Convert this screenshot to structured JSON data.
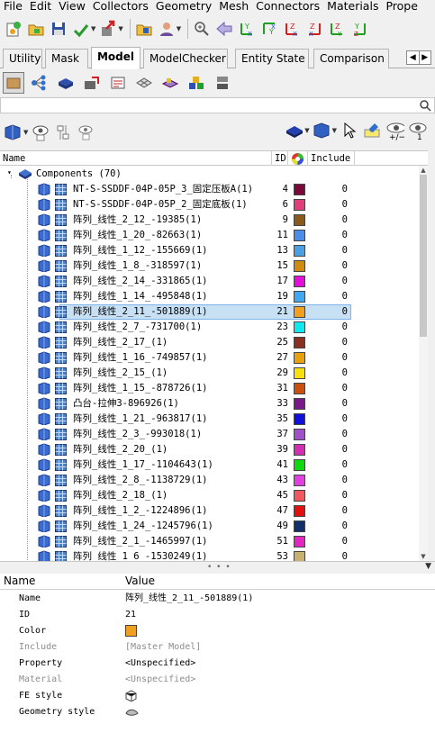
{
  "menu": [
    "File",
    "Edit",
    "View",
    "Collectors",
    "Geometry",
    "Mesh",
    "Connectors",
    "Materials",
    "Prope"
  ],
  "tabs": [
    {
      "label": "Utility",
      "active": false
    },
    {
      "label": "Mask",
      "active": false
    },
    {
      "label": "Model",
      "active": true
    },
    {
      "label": "ModelChecker",
      "active": false
    },
    {
      "label": "Entity State",
      "active": false
    },
    {
      "label": "Comparison",
      "active": false
    }
  ],
  "tab_nav": {
    "left": "◀",
    "right": "▶"
  },
  "columns": {
    "name": "Name",
    "id": "ID",
    "include": "Include"
  },
  "tree": {
    "root_label": "Components (70)",
    "rows": [
      {
        "name": "NT-S-SSDDF-04P-05P_3_固定压板A(1)",
        "id": "4",
        "color": "#7a0a3c",
        "include": "0"
      },
      {
        "name": "NT-S-SSDDF-04P-05P_2_固定底板(1)",
        "id": "6",
        "color": "#e0407a",
        "include": "0"
      },
      {
        "name": "阵列_线性_2_12_-19385(1)",
        "id": "9",
        "color": "#8a5a1a",
        "include": "0"
      },
      {
        "name": "阵列_线性_1_20_-82663(1)",
        "id": "11",
        "color": "#4a8de8",
        "include": "0"
      },
      {
        "name": "阵列_线性_1_12_-155669(1)",
        "id": "13",
        "color": "#4aa0e0",
        "include": "0"
      },
      {
        "name": "阵列_线性_1_8_-318597(1)",
        "id": "15",
        "color": "#d08a10",
        "include": "0"
      },
      {
        "name": "阵列_线性_2_14_-331865(1)",
        "id": "17",
        "color": "#e010d8",
        "include": "0"
      },
      {
        "name": "阵列_线性_1_14_-495848(1)",
        "id": "19",
        "color": "#40a8f0",
        "include": "0"
      },
      {
        "name": "阵列_线性_2_11_-501889(1)",
        "id": "21",
        "color": "#f0a020",
        "include": "0",
        "selected": true
      },
      {
        "name": "阵列_线性_2_7_-731700(1)",
        "id": "23",
        "color": "#10e8f0",
        "include": "0"
      },
      {
        "name": "阵列_线性_2_17_(1)",
        "id": "25",
        "color": "#8a3020",
        "include": "0"
      },
      {
        "name": "阵列_线性_1_16_-749857(1)",
        "id": "27",
        "color": "#e8a010",
        "include": "0"
      },
      {
        "name": "阵列_线性_2_15_(1)",
        "id": "29",
        "color": "#f8e010",
        "include": "0"
      },
      {
        "name": "阵列_线性_1_15_-878726(1)",
        "id": "31",
        "color": "#c85010",
        "include": "0"
      },
      {
        "name": "凸台-拉伸3-896926(1)",
        "id": "33",
        "color": "#7a1a8a",
        "include": "0"
      },
      {
        "name": "阵列_线性_1_21_-963817(1)",
        "id": "35",
        "color": "#1010d8",
        "include": "0"
      },
      {
        "name": "阵列_线性_2_3_-993018(1)",
        "id": "37",
        "color": "#a050c8",
        "include": "0"
      },
      {
        "name": "阵列_线性_2_20_(1)",
        "id": "39",
        "color": "#d030b0",
        "include": "0"
      },
      {
        "name": "阵列_线性_1_17_-1104643(1)",
        "id": "41",
        "color": "#10d810",
        "include": "0"
      },
      {
        "name": "阵列_线性_2_8_-1138729(1)",
        "id": "43",
        "color": "#e040e0",
        "include": "0"
      },
      {
        "name": "阵列_线性_2_18_(1)",
        "id": "45",
        "color": "#f05860",
        "include": "0"
      },
      {
        "name": "阵列_线性_1_2_-1224896(1)",
        "id": "47",
        "color": "#e01010",
        "include": "0"
      },
      {
        "name": "阵列_线性_1_24_-1245796(1)",
        "id": "49",
        "color": "#10306a",
        "include": "0"
      },
      {
        "name": "阵列_线性_2_1_-1465997(1)",
        "id": "51",
        "color": "#e028c0",
        "include": "0"
      },
      {
        "name": "阵列_线性_1_6_-1530249(1)",
        "id": "53",
        "color": "#c8b070",
        "include": "0"
      }
    ]
  },
  "properties": {
    "header": {
      "name": "Name",
      "value": "Value"
    },
    "rows": [
      {
        "name": "Name",
        "value": "阵列_线性_2_11_-501889(1)",
        "grey": false,
        "kind": "text"
      },
      {
        "name": "ID",
        "value": "21",
        "grey": false,
        "kind": "text"
      },
      {
        "name": "Color",
        "value": "",
        "grey": false,
        "kind": "color",
        "color": "#f0a020"
      },
      {
        "name": "Include",
        "value": "[Master Model]",
        "grey": true,
        "kind": "text"
      },
      {
        "name": "Property",
        "value": "<Unspecified>",
        "grey": false,
        "kind": "text"
      },
      {
        "name": "Material",
        "value": "<Unspecified>",
        "grey": true,
        "kind": "text"
      },
      {
        "name": "FE style",
        "value": "",
        "grey": false,
        "kind": "fe-icon"
      },
      {
        "name": "Geometry style",
        "value": "",
        "grey": false,
        "kind": "geom-icon"
      }
    ]
  }
}
